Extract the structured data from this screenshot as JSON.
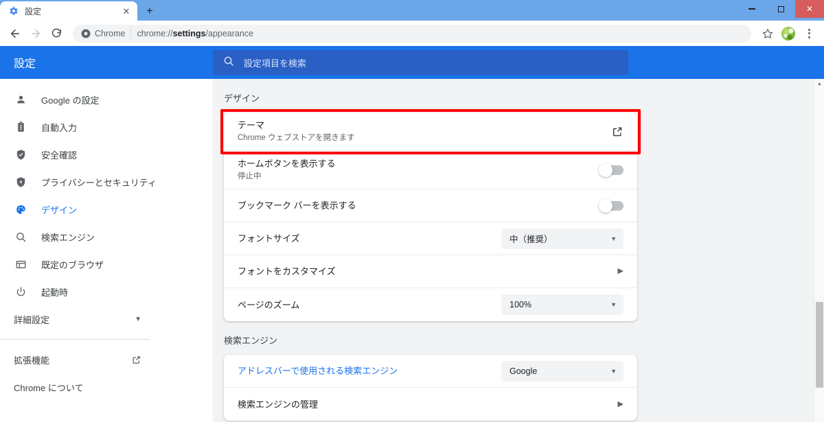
{
  "window": {
    "controls": {
      "minimize": "minimize-icon",
      "maximize": "maximize-icon",
      "close": "✕"
    }
  },
  "tabstrip": {
    "tab_title": "設定",
    "tab_favicon": "gear-icon",
    "close_label": "✕",
    "newtab_label": "+"
  },
  "toolbar": {
    "back": "←",
    "forward": "→",
    "reload": "⟳",
    "omnibox": {
      "chip_label": "Chrome",
      "url_prefix": "chrome://",
      "url_bold": "settings",
      "url_suffix": "/appearance",
      "full_url": "chrome://settings/appearance"
    },
    "star": "☆",
    "avatar": "profile-avatar",
    "menu": "kebab-menu-icon"
  },
  "settings_header": {
    "brand": "設定",
    "search_placeholder": "設定項目を検索",
    "search_icon": "search-icon",
    "accent_color": "#1a73e8",
    "search_bg": "#2a5fc4"
  },
  "sidebar": {
    "items": [
      {
        "label": "Google の設定",
        "icon": "person-icon",
        "active": false
      },
      {
        "label": "自動入力",
        "icon": "clipboard-icon",
        "active": false
      },
      {
        "label": "安全確認",
        "icon": "shield-check-icon",
        "active": false
      },
      {
        "label": "プライバシーとセキュリティ",
        "icon": "shield-lock-icon",
        "active": false
      },
      {
        "label": "デザイン",
        "icon": "palette-icon",
        "active": true
      },
      {
        "label": "検索エンジン",
        "icon": "search-icon",
        "active": false
      },
      {
        "label": "既定のブラウザ",
        "icon": "browser-window-icon",
        "active": false
      },
      {
        "label": "起動時",
        "icon": "power-icon",
        "active": false
      }
    ],
    "advanced": {
      "label": "詳細設定",
      "caret": "▾"
    },
    "extensions": {
      "label": "拡張機能",
      "icon": "external-link-icon"
    },
    "about": {
      "label": "Chrome について"
    }
  },
  "main": {
    "sections": [
      {
        "title": "デザイン",
        "rows": [
          {
            "title": "テーマ",
            "sub": "Chrome ウェブストアを開きます",
            "control": "external-link",
            "highlighted": true
          },
          {
            "title": "ホームボタンを表示する",
            "sub": "停止中",
            "control": "toggle",
            "toggle_on": false
          },
          {
            "title": "ブックマーク バーを表示する",
            "sub": "",
            "control": "toggle",
            "toggle_on": false
          },
          {
            "title": "フォントサイズ",
            "sub": "",
            "control": "select",
            "value": "中（推奨）"
          },
          {
            "title": "フォントをカスタマイズ",
            "sub": "",
            "control": "arrow"
          },
          {
            "title": "ページのズーム",
            "sub": "",
            "control": "select",
            "value": "100%"
          }
        ]
      },
      {
        "title": "検索エンジン",
        "rows": [
          {
            "title": "アドレスバーで使用される検索エンジン",
            "sub": "",
            "control": "select",
            "value": "Google",
            "link": true
          },
          {
            "title": "検索エンジンの管理",
            "sub": "",
            "control": "arrow"
          }
        ]
      }
    ]
  },
  "annotation": {
    "highlight_color": "#ff0000",
    "target": "テーマ"
  }
}
